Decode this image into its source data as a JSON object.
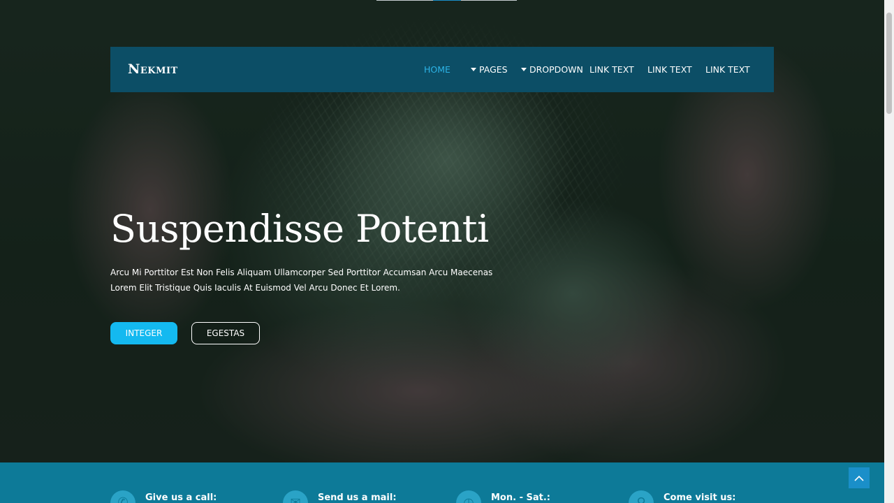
{
  "brand": {
    "name": "Nekmit"
  },
  "nav": {
    "items": [
      {
        "label": "HOME",
        "active": true,
        "dropdown": false
      },
      {
        "label": "PAGES",
        "active": false,
        "dropdown": true
      },
      {
        "label": "DROPDOWN",
        "active": false,
        "dropdown": true
      },
      {
        "label": "LINK TEXT",
        "active": false,
        "dropdown": false
      },
      {
        "label": "LINK TEXT",
        "active": false,
        "dropdown": false
      },
      {
        "label": "LINK TEXT",
        "active": false,
        "dropdown": false
      }
    ]
  },
  "hero": {
    "title": "Suspendisse Potenti",
    "text": "Arcu Mi Porttitor Est Non Felis Aliquam Ullamcorper Sed Porttitor Accumsan Arcu Maecenas Lorem Elit Tristique Quis Iaculis At Euismod Vel Arcu Donec Et Lorem.",
    "primary_button": "INTEGER",
    "secondary_button": "EGESTAS"
  },
  "contact": {
    "items": [
      {
        "label": "Give us a call:",
        "icon": "phone-icon"
      },
      {
        "label": "Send us a mail:",
        "icon": "mail-icon"
      },
      {
        "label": "Mon. - Sat.:",
        "icon": "clock-icon"
      },
      {
        "label": "Come visit us:",
        "icon": "location-icon"
      }
    ]
  },
  "colors": {
    "navbar": "#0c4e66",
    "accent": "#14b9f0",
    "nav_active": "#2cb3e6",
    "contact_band": "#0d7a98",
    "to_top": "#1a8fc9"
  }
}
